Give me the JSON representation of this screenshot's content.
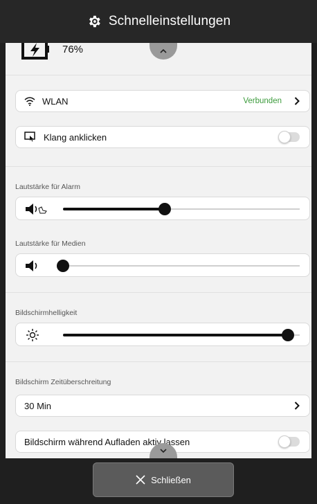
{
  "header": {
    "title": "Schnelleinstellungen",
    "icon": "gear-icon"
  },
  "battery": {
    "percent": "76%",
    "icon": "battery-charging-icon"
  },
  "wlan": {
    "label": "WLAN",
    "status": "Verbunden",
    "status_color": "#3c9b3c",
    "icon": "wifi-icon"
  },
  "click_sound": {
    "label": "Klang anklicken",
    "enabled": false,
    "icon": "tap-screen-icon"
  },
  "alarm_volume": {
    "label": "Lautstärke für Alarm",
    "level": 0.43,
    "icon": "volume-alarm-icon"
  },
  "media_volume": {
    "label": "Lautstärke für Medien",
    "level": 0.0,
    "icon": "volume-icon"
  },
  "brightness": {
    "label": "Bildschirmhelligkeit",
    "level": 0.95,
    "icon": "sun-icon"
  },
  "screen_timeout": {
    "label": "Bildschirm Zeitüberschreitung",
    "value": "30 Min"
  },
  "keep_awake": {
    "label": "Bildschirm während Aufladen aktiv lassen",
    "enabled": false
  },
  "footer": {
    "close_label": "Schließen",
    "icon": "close-icon"
  }
}
